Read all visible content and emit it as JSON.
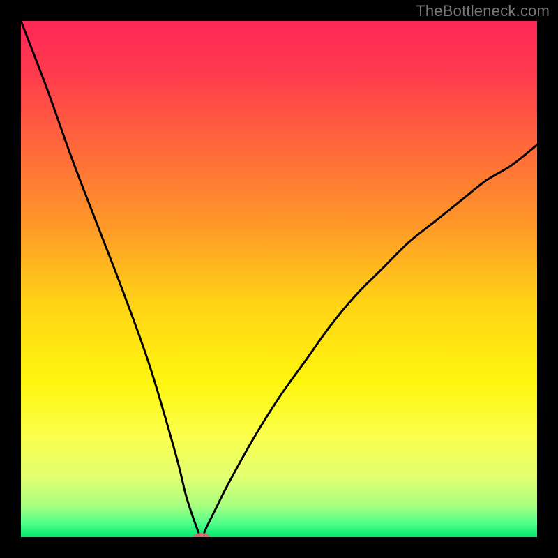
{
  "watermark": "TheBottleneck.com",
  "chart_data": {
    "type": "line",
    "title": "",
    "xlabel": "",
    "ylabel": "",
    "xlim": [
      0,
      100
    ],
    "ylim": [
      0,
      100
    ],
    "grid": false,
    "legend": false,
    "series": [
      {
        "name": "bottleneck-curve",
        "x": [
          0,
          5,
          10,
          15,
          20,
          25,
          30,
          32,
          34,
          35,
          36,
          38,
          40,
          45,
          50,
          55,
          60,
          65,
          70,
          75,
          80,
          85,
          90,
          95,
          100
        ],
        "y": [
          100,
          87,
          73,
          60,
          47,
          33,
          16,
          8,
          2,
          0,
          2,
          6,
          10,
          19,
          27,
          34,
          41,
          47,
          52,
          57,
          61,
          65,
          69,
          72,
          76
        ]
      }
    ],
    "marker": {
      "name": "ideal-point",
      "x": 35,
      "y": 0,
      "color": "#c9756c",
      "rx": 12,
      "ry": 6
    },
    "background_gradient": {
      "stops": [
        {
          "offset": 0.0,
          "color": "#ff2857"
        },
        {
          "offset": 0.1,
          "color": "#ff3a4e"
        },
        {
          "offset": 0.25,
          "color": "#ff6a3a"
        },
        {
          "offset": 0.4,
          "color": "#ff9a28"
        },
        {
          "offset": 0.55,
          "color": "#ffd416"
        },
        {
          "offset": 0.7,
          "color": "#fff60e"
        },
        {
          "offset": 0.8,
          "color": "#fbff4a"
        },
        {
          "offset": 0.88,
          "color": "#e4ff70"
        },
        {
          "offset": 0.94,
          "color": "#a8ff80"
        },
        {
          "offset": 0.975,
          "color": "#4bff88"
        },
        {
          "offset": 1.0,
          "color": "#00e76f"
        }
      ]
    }
  }
}
